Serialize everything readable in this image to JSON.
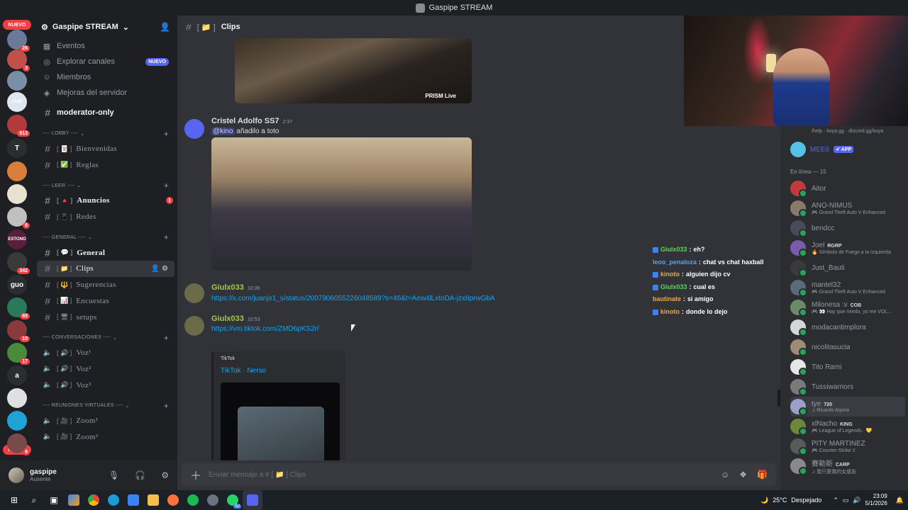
{
  "window_title": "Gaspipe STREAM",
  "rail": {
    "nuevo_top": "NUEVO",
    "nuevo_bottom": "NUEVO",
    "servers": [
      {
        "label": "",
        "badge": "26",
        "color": "#6b7a99"
      },
      {
        "label": "",
        "badge": "3",
        "color": "#c1504a"
      },
      {
        "label": "",
        "badge": "",
        "color": "#7a8ea8"
      },
      {
        "label": "JADE",
        "badge": "",
        "color": "#dfe6f0"
      },
      {
        "label": "",
        "badge": "613",
        "color": "#b23a3a"
      },
      {
        "label": "T",
        "badge": "",
        "color": "#2b2d31"
      },
      {
        "label": "",
        "badge": "",
        "color": "#d97f3a"
      },
      {
        "label": "",
        "badge": "",
        "color": "#e8e1cf"
      },
      {
        "label": "",
        "badge": "6",
        "color": "#c0c0c0"
      },
      {
        "label": "ESTONO",
        "badge": "",
        "color": "#5a1f3a"
      },
      {
        "label": "",
        "badge": "342",
        "color": "#3a3a3a"
      },
      {
        "label": "guo",
        "badge": "",
        "color": "#2b2d31"
      },
      {
        "label": "",
        "badge": "65",
        "color": "#2a7a5a"
      },
      {
        "label": "",
        "badge": "10",
        "color": "#8a3a3a"
      },
      {
        "label": "",
        "badge": "17",
        "color": "#4a8a3a"
      },
      {
        "label": "a",
        "badge": "",
        "color": "#2b2d31"
      },
      {
        "label": "",
        "badge": "",
        "color": "#e0e0e0"
      },
      {
        "label": "",
        "badge": "",
        "color": "#1fa3d6"
      },
      {
        "label": "",
        "badge": "9",
        "color": "#7a4a4a"
      }
    ]
  },
  "sidebar": {
    "server_name": "Gaspipe STREAM",
    "nav": [
      {
        "label": "Eventos",
        "icon": "calendar-icon"
      },
      {
        "label": "Explorar canales",
        "icon": "compass-icon",
        "tag": "NUEVO"
      },
      {
        "label": "Miembros",
        "icon": "members-icon"
      },
      {
        "label": "Mejoras del servidor",
        "icon": "boost-icon"
      }
    ],
    "pinned_channel": "moderator-only",
    "categories": [
      {
        "name": "---- LOBBY ----",
        "channels": [
          {
            "label": "Bienvenidas",
            "prefix": "[ 🃏 ]",
            "style": "serif"
          },
          {
            "label": "Reglas",
            "prefix": "[ ✅ ]",
            "style": "serif"
          }
        ]
      },
      {
        "name": "---- LEER ----",
        "channels": [
          {
            "label": "Anuncios",
            "prefix": "[ 🔺 ]",
            "badge": "1",
            "style": "bold"
          },
          {
            "label": "Redes",
            "prefix": "[ 📱 ]"
          }
        ]
      },
      {
        "name": "---- GENERAL ----",
        "channels": [
          {
            "label": "General",
            "prefix": "[ 💬 ]",
            "style": "bold"
          },
          {
            "label": "Clips",
            "prefix": "[ 📁 ]",
            "style": "active"
          },
          {
            "label": "Sugerencias",
            "prefix": "[ 🔱 ]"
          },
          {
            "label": "Encuestas",
            "prefix": "[ 📊 ]"
          },
          {
            "label": "setups",
            "prefix": "[ 🖥 ]"
          }
        ]
      },
      {
        "name": "---- CONVERSACIONES ----",
        "channels": [
          {
            "label": "Voz¹",
            "prefix": "[ 🔊 ]",
            "voice": true
          },
          {
            "label": "Voz²",
            "prefix": "[ 🔊 ]",
            "voice": true
          },
          {
            "label": "Voz³",
            "prefix": "[ 🔊 ]",
            "voice": true
          }
        ]
      },
      {
        "name": "---- REUNIONES VIRTUALES ----",
        "channels": [
          {
            "label": "Zoom¹",
            "prefix": "[ 🎥 ]",
            "voice": true
          },
          {
            "label": "Zoom²",
            "prefix": "[ 🎥 ]",
            "voice": true
          }
        ]
      }
    ]
  },
  "user": {
    "name": "gaspipe",
    "status": "Ausente"
  },
  "channel_header": {
    "prefix": "[ 📁 ]",
    "name": "Clips"
  },
  "messages": {
    "prism_label": "PRISM Live",
    "m1": {
      "author": "Cristel Adolfo SS7",
      "time": "2:37",
      "mention": "@kino",
      "text": "añadilo a toto",
      "author_color": "#dbdee1"
    },
    "m2": {
      "author": "Giulx033",
      "time": "10:36",
      "link": "https://x.com/juanjs1_s/status/2007906055226048589?s=46&t=Aew4lLxtoDA-jzx8prwGbA",
      "author_color": "#a3c94a"
    },
    "m3": {
      "author": "Giulx033",
      "time": "10:53",
      "link": "https://vm.tiktok.com/ZMD6pKS2r/",
      "author_color": "#a3c94a"
    },
    "embed": {
      "provider": "TikTok",
      "title": "TikTok · Nerso"
    }
  },
  "overlay_chat": [
    {
      "user": "Giulx033",
      "msg": "eh?",
      "color": "#5ad65a",
      "badge": true
    },
    {
      "user": "leoo_penaloza",
      "msg": "chat vs chat haxball",
      "color": "#5aa0e8",
      "badge": false
    },
    {
      "user": "kinoto",
      "msg": "alguien dijo cv",
      "color": "#e8a84a",
      "badge": true
    },
    {
      "user": "Giulx033",
      "msg": "cual es",
      "color": "#5ad65a",
      "badge": true
    },
    {
      "user": "bautinate",
      "msg": "si amigo",
      "color": "#e8a84a",
      "badge": false
    },
    {
      "user": "kinoto",
      "msg": "donde lo dejo",
      "color": "#e8a84a",
      "badge": true
    }
  ],
  "composer": {
    "placeholder": "Enviar mensaje a # [ 📁 ]",
    "channel": "Clips"
  },
  "members": {
    "top_text": "/help · koya.gg · discord.gg/koya",
    "bot": {
      "name": "MEE6",
      "tag": "✔ APP"
    },
    "online_header": "En línea — 15",
    "list": [
      {
        "name": "Aitor",
        "activity": "",
        "tag": "",
        "color": "#c23a3a"
      },
      {
        "name": "ANO-NIMUS",
        "activity": "🎮 Grand Theft Auto V Enhanced",
        "tag": "",
        "color": "#8a7a6a"
      },
      {
        "name": "bendcc",
        "activity": "",
        "tag": "",
        "color": "#4a4a5a"
      },
      {
        "name": "Joel",
        "activity": "🔥 Símbolo de Fuego a la Izquierda",
        "tag": "RGRP",
        "color": "#7a5aaa"
      },
      {
        "name": "Just_Bauti",
        "activity": "",
        "tag": "",
        "color": "#3a3a3a"
      },
      {
        "name": "mantel32",
        "activity": "🎮 Grand Theft Auto V Enhanced",
        "tag": "",
        "color": "#5a6a7a"
      },
      {
        "name": "Milonesa :v",
        "activity": "🎮 👀 Hay que miedo, yo me VOL...",
        "tag": "COB",
        "color": "#6a8a6a"
      },
      {
        "name": "modacantimplora",
        "activity": "",
        "tag": "",
        "color": "#d6d6d6"
      },
      {
        "name": "nicolitasucia",
        "activity": "",
        "tag": "",
        "color": "#a08a7a"
      },
      {
        "name": "Tito Rami",
        "activity": "",
        "tag": "",
        "color": "#e6e6e6"
      },
      {
        "name": "Tussiwarriors",
        "activity": "",
        "tag": "",
        "color": "#7a7a7a"
      },
      {
        "name": "tye",
        "activity": "♫ Ricardo Arjona",
        "tag": "720",
        "color": "#9aa0c8"
      },
      {
        "name": "xlNacho",
        "activity": "🎮 League of Legends · 💛",
        "tag": "KING",
        "color": "#6a8a3a"
      },
      {
        "name": "PITY MARTINEZ",
        "activity": "🎮 Counter-Strike 2",
        "tag": "",
        "color": "#5a5a5a"
      },
      {
        "name": "賽勒斯",
        "activity": "♫ 我只愛我的女朋友",
        "tag": "CARP",
        "color": "#8a8a8a"
      }
    ]
  },
  "taskbar": {
    "weather_temp": "25°C",
    "weather_desc": "Despejado",
    "time": "23:09",
    "date": "5/1/2026",
    "badge_whatsapp": "52"
  }
}
